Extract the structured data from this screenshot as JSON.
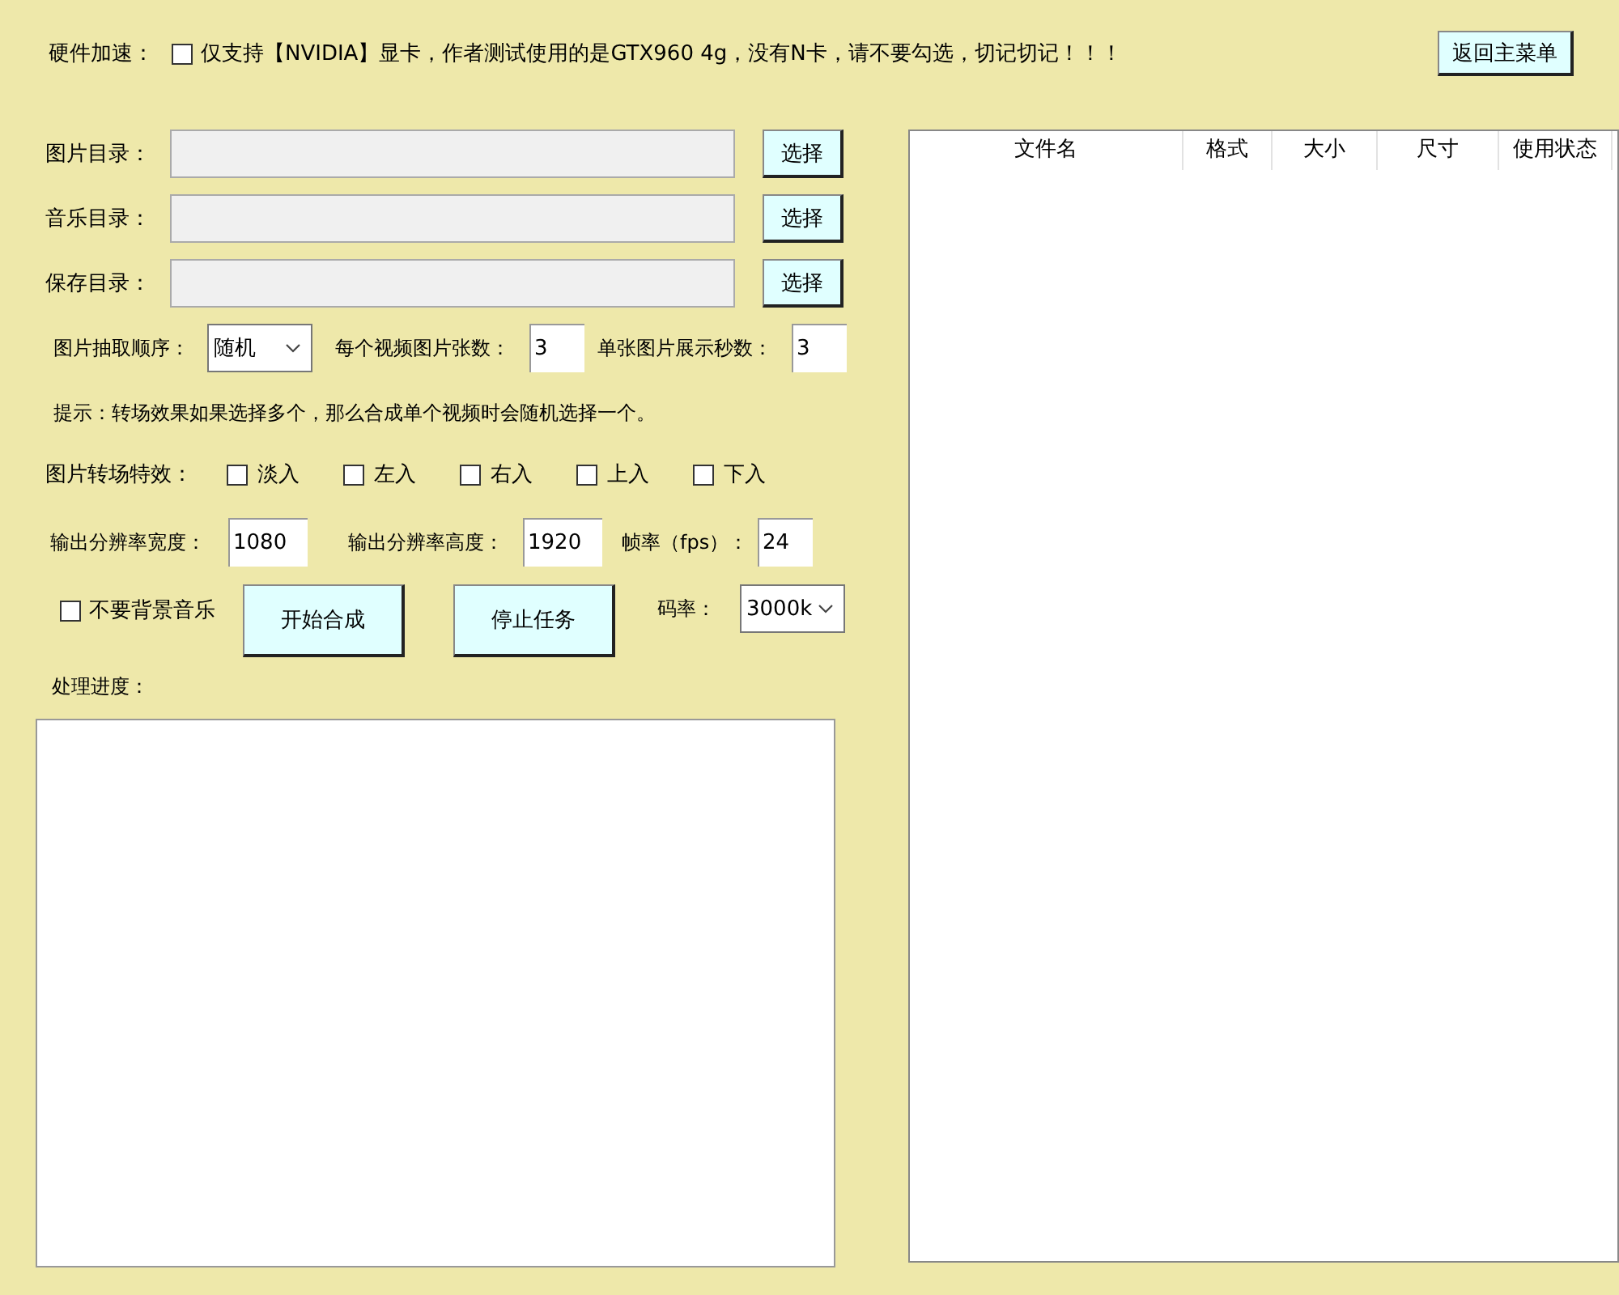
{
  "hardware_accel": {
    "label": "硬件加速：",
    "checkbox": {
      "label": "仅支持【NVIDIA】显卡，作者测试使用的是GTX960 4g，没有N卡，请不要勾选，切记切记！！！",
      "checked": false
    }
  },
  "back_button": "返回主菜单",
  "directories": [
    {
      "label": "图片目录：",
      "button": "选择"
    },
    {
      "label": "音乐目录：",
      "button": "选择"
    },
    {
      "label": "保存目录：",
      "button": "选择"
    }
  ],
  "options": {
    "order_label": "图片抽取顺序：",
    "order_value": "随机",
    "count_label": "每个视频图片张数：",
    "count_value": "3",
    "seconds_label": "单张图片展示秒数：",
    "seconds_value": "3"
  },
  "hint": "提示：转场效果如果选择多个，那么合成单个视频时会随机选择一个。",
  "transitions": {
    "label": "图片转场特效：",
    "options": [
      {
        "label": "淡入",
        "checked": false
      },
      {
        "label": "左入",
        "checked": false
      },
      {
        "label": "右入",
        "checked": false
      },
      {
        "label": "上入",
        "checked": false
      },
      {
        "label": "下入",
        "checked": false
      }
    ]
  },
  "resolution": {
    "width_label": "输出分辨率宽度：",
    "width_value": "1080",
    "height_label": "输出分辨率高度：",
    "height_value": "1920",
    "fps_label": "帧率（fps）：",
    "fps_value": "24"
  },
  "no_music": {
    "label": "不要背景音乐",
    "checked": false
  },
  "start_button": "开始合成",
  "stop_button": "停止任务",
  "bitrate": {
    "label": "码率：",
    "value": "3000k"
  },
  "progress": {
    "label": "处理进度："
  },
  "file_table": {
    "columns": [
      "文件名",
      "格式",
      "大小",
      "尺寸",
      "使用状态"
    ]
  }
}
